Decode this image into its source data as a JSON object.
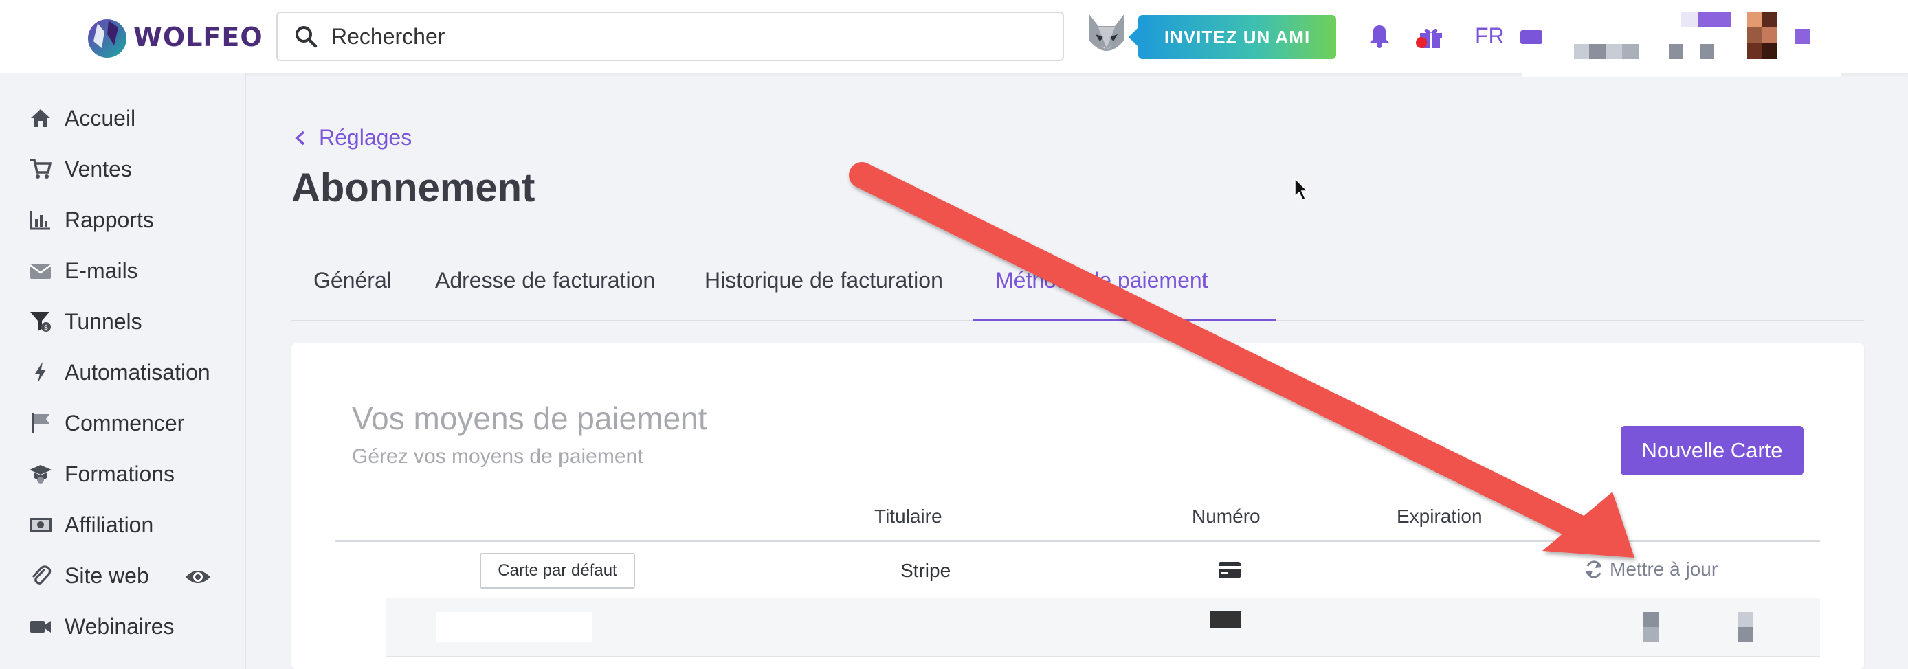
{
  "brand": {
    "name": "WOLFEO",
    "accent_color": "#7b55d9",
    "logo_icon": "wolf-logo-icon"
  },
  "header": {
    "search_placeholder": "Rechercher",
    "invite_label": "INVITEZ UN AMI",
    "language": "FR",
    "icons": [
      "search-icon",
      "wolf-avatar-icon",
      "bell-icon",
      "gift-icon",
      "flag-icon"
    ]
  },
  "sidebar": {
    "items": [
      {
        "label": "Accueil",
        "icon": "home-icon"
      },
      {
        "label": "Ventes",
        "icon": "cart-icon"
      },
      {
        "label": "Rapports",
        "icon": "bar-chart-icon"
      },
      {
        "label": "E-mails",
        "icon": "envelope-icon"
      },
      {
        "label": "Tunnels",
        "icon": "funnel-icon"
      },
      {
        "label": "Automatisation",
        "icon": "bolt-icon"
      },
      {
        "label": "Commencer",
        "icon": "flag-icon"
      },
      {
        "label": "Formations",
        "icon": "graduation-cap-icon"
      },
      {
        "label": "Affiliation",
        "icon": "money-icon"
      },
      {
        "label": "Site web",
        "icon": "paperclip-icon"
      },
      {
        "label": "Webinaires",
        "icon": "video-icon"
      }
    ]
  },
  "main": {
    "breadcrumb": "Réglages",
    "title": "Abonnement",
    "tabs": [
      {
        "label": "Général",
        "active": false
      },
      {
        "label": "Adresse de facturation",
        "active": false
      },
      {
        "label": "Historique de facturation",
        "active": false
      },
      {
        "label": "Méthode de paiement",
        "active": true
      }
    ]
  },
  "payment": {
    "title": "Vos moyens de paiement",
    "subtitle": "Gérez vos moyens de paiement",
    "new_card_label": "Nouvelle Carte",
    "columns": [
      "Titulaire",
      "Numéro",
      "Expiration"
    ],
    "rows": [
      {
        "default_label": "Carte par défaut",
        "holder": "Stripe",
        "number_icon": "credit-card-icon",
        "expiration": "",
        "action": "Mettre à jour"
      }
    ]
  },
  "annotation": {
    "arrow_color": "#f0524b"
  }
}
